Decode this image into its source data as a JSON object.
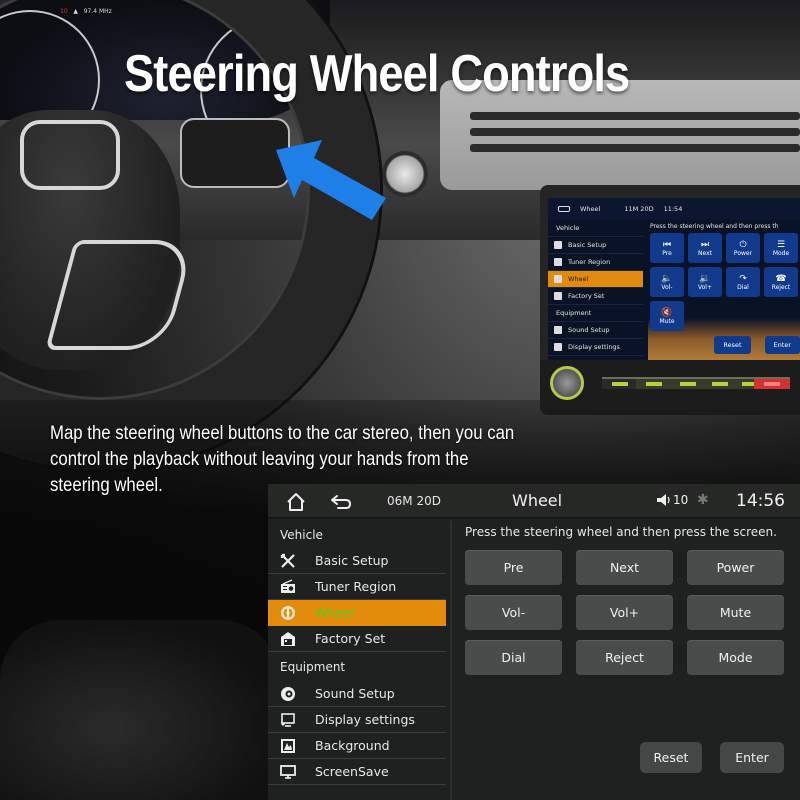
{
  "headline": "Steering Wheel Controls",
  "description": "Map the steering wheel buttons to the car stereo, then you can control the playback without leaving your hands from the steering wheel.",
  "cluster": {
    "readout": "97.4 MHz",
    "fuel": "10"
  },
  "mini_display": {
    "title": "Wheel",
    "date": "11M 20D",
    "time": "11:54",
    "hint": "Press the steering wheel and then press th",
    "sidebar": [
      {
        "label": "Vehicle",
        "header": true
      },
      {
        "label": "Basic Setup"
      },
      {
        "label": "Tuner Region"
      },
      {
        "label": "Wheel",
        "active": true
      },
      {
        "label": "Factory Set"
      },
      {
        "label": "Equipment",
        "header": true
      },
      {
        "label": "Sound Setup"
      },
      {
        "label": "Display settings"
      }
    ],
    "buttons": [
      {
        "label": "Pre",
        "glyph": "⏮"
      },
      {
        "label": "Next",
        "glyph": "⏭"
      },
      {
        "label": "Power",
        "glyph": "⏻"
      },
      {
        "label": "Mode",
        "glyph": "☰"
      },
      {
        "label": "Vol-",
        "glyph": "🔈"
      },
      {
        "label": "Vol+",
        "glyph": "🔉"
      },
      {
        "label": "Dial",
        "glyph": "↷"
      },
      {
        "label": "Reject",
        "glyph": "☎"
      },
      {
        "label": "Mute",
        "glyph": "🔇"
      }
    ],
    "reset": "Reset",
    "enter": "Enter"
  },
  "panel": {
    "topbar": {
      "date": "06M 20D",
      "title": "Wheel",
      "volume": "10",
      "time": "14:56",
      "icons": [
        "home-icon",
        "back-icon",
        "speaker-icon",
        "bluetooth-icon"
      ]
    },
    "sidebar": {
      "section_vehicle": "Vehicle",
      "section_equipment": "Equipment",
      "vehicle_items": [
        {
          "label": "Basic Setup",
          "icon": "tools-icon"
        },
        {
          "label": "Tuner Region",
          "icon": "radio-icon"
        },
        {
          "label": "Wheel",
          "icon": "steering-wheel-icon",
          "active": true
        },
        {
          "label": "Factory Set",
          "icon": "factory-icon"
        }
      ],
      "equipment_items": [
        {
          "label": "Sound Setup",
          "icon": "sound-icon"
        },
        {
          "label": "Display settings",
          "icon": "display-icon"
        },
        {
          "label": "Background",
          "icon": "background-icon"
        },
        {
          "label": "ScreenSave",
          "icon": "screensaver-icon"
        }
      ]
    },
    "hint": "Press the steering wheel and then press the screen.",
    "buttons": [
      "Pre",
      "Next",
      "Power",
      "Vol-",
      "Vol+",
      "Mute",
      "Dial",
      "Reject",
      "Mode"
    ],
    "reset": "Reset",
    "enter": "Enter"
  },
  "colors": {
    "accent_orange": "#e38c0c",
    "active_label_green": "#4cd01e",
    "arrow_blue": "#1f7fe8",
    "mini_button_blue": "#123a8c"
  }
}
